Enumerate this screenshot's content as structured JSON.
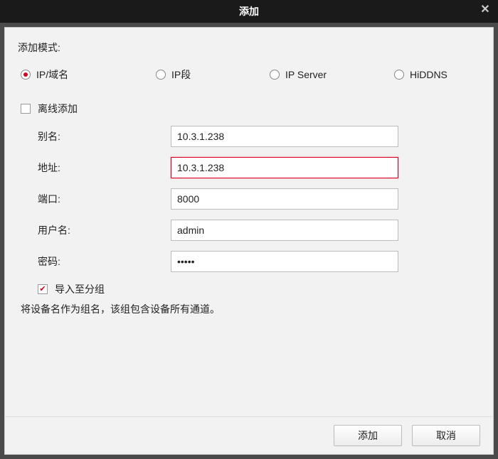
{
  "dialog": {
    "title": "添加"
  },
  "mode": {
    "label": "添加模式:",
    "options": {
      "ip_domain": "IP/域名",
      "ip_segment": "IP段",
      "ip_server": "IP Server",
      "hiddns": "HiDDNS"
    },
    "selected": "ip_domain"
  },
  "offline": {
    "label": "离线添加",
    "checked": false
  },
  "fields": {
    "alias": {
      "label": "别名:",
      "value": "10.3.1.238"
    },
    "address": {
      "label": "地址:",
      "value": "10.3.1.238"
    },
    "port": {
      "label": "端口:",
      "value": "8000"
    },
    "username": {
      "label": "用户名:",
      "value": "admin"
    },
    "password": {
      "label": "密码:",
      "value": "•••••"
    }
  },
  "import_group": {
    "label": "导入至分组",
    "checked": true
  },
  "hint": "将设备名作为组名，该组包含设备所有通道。",
  "buttons": {
    "add": "添加",
    "cancel": "取消"
  }
}
